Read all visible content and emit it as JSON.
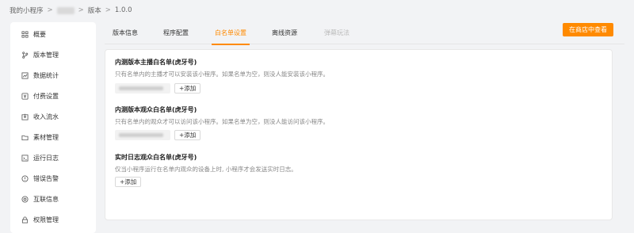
{
  "breadcrumb": {
    "my_app": "我的小程序",
    "sep": ">",
    "version_label": "版本",
    "current": "1.0.0"
  },
  "sidebar": {
    "items": [
      {
        "label": "概要",
        "icon": "grid-icon"
      },
      {
        "label": "版本管理",
        "icon": "branch-icon"
      },
      {
        "label": "数据统计",
        "icon": "chart-icon"
      },
      {
        "label": "付费设置",
        "icon": "payment-icon"
      },
      {
        "label": "收入流水",
        "icon": "income-icon"
      },
      {
        "label": "素材管理",
        "icon": "folder-icon"
      },
      {
        "label": "运行日志",
        "icon": "log-icon"
      },
      {
        "label": "错误告警",
        "icon": "alert-icon"
      },
      {
        "label": "互联信息",
        "icon": "link-icon"
      },
      {
        "label": "权限管理",
        "icon": "lock-icon"
      }
    ]
  },
  "tabs": [
    {
      "label": "版本信息",
      "state": "normal"
    },
    {
      "label": "程序配置",
      "state": "normal"
    },
    {
      "label": "白名单设置",
      "state": "active"
    },
    {
      "label": "离线资源",
      "state": "normal"
    },
    {
      "label": "弹幕玩法",
      "state": "disabled"
    }
  ],
  "store_button": "在商店中查看",
  "sections": [
    {
      "title": "内测版本主播白名单(虎牙号)",
      "desc": "只有名单内的主播才可以安装该小程序。如果名单为空，则没人能安装该小程序。",
      "add_label": "+添加"
    },
    {
      "title": "内测版本观众白名单(虎牙号)",
      "desc": "只有名单内的观众才可以访问该小程序。如果名单为空，则没人能访问该小程序。",
      "add_label": "+添加"
    },
    {
      "title": "实时日志观众白名单(虎牙号)",
      "desc": "仅当小程序运行在名单内观众的设备上时, 小程序才会发送实时日志。",
      "add_label": "+添加"
    }
  ],
  "colors": {
    "accent": "#ff8a00",
    "page_bg": "#f2f3f5",
    "disabled": "#bbbbbb"
  }
}
